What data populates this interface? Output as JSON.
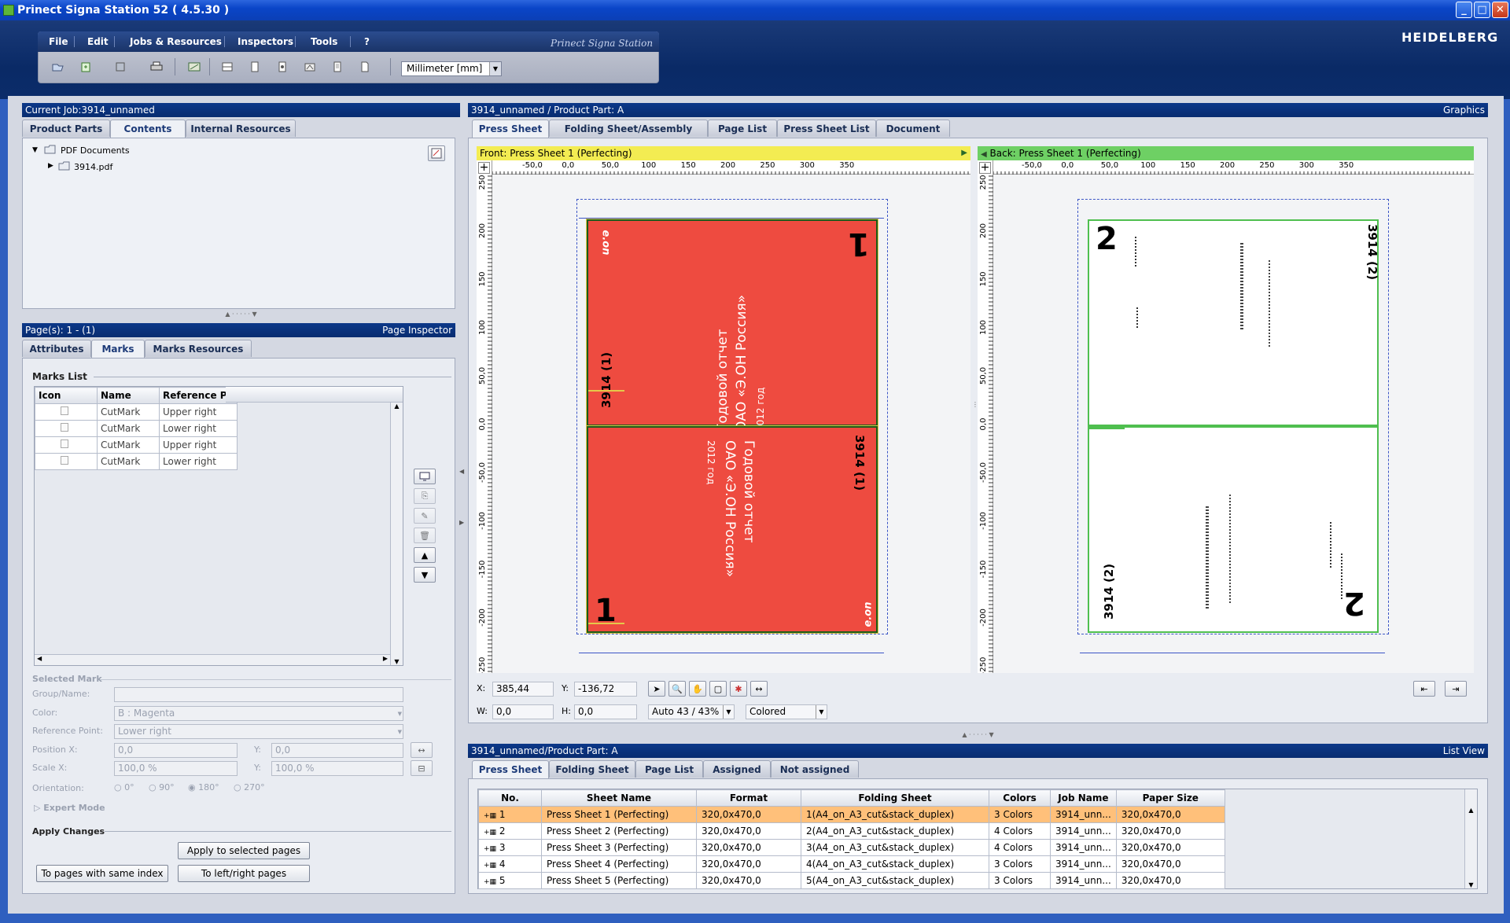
{
  "window": {
    "title": "Prinect Signa Station 52 ( 4.5.30 )",
    "brand": "Prinect Signa Station",
    "logo": "HEIDELBERG"
  },
  "menu": [
    "File",
    "Edit",
    "Jobs & Resources",
    "Inspectors",
    "Tools",
    "?"
  ],
  "toolbar": {
    "units": "Millimeter  [mm]"
  },
  "job_panel": {
    "title": "Current Job:3914_unnamed",
    "tabs": [
      "Product Parts",
      "Contents",
      "Internal Resources"
    ],
    "active_tab": "Contents",
    "tree": {
      "root": "PDF Documents",
      "child": "3914.pdf"
    }
  },
  "page_inspector": {
    "title": "Page(s): 1 - (1)",
    "title_right": "Page Inspector",
    "tabs": [
      "Attributes",
      "Marks",
      "Marks Resources"
    ],
    "active_tab": "Marks",
    "marks_list_label": "Marks List",
    "columns": [
      "Icon",
      "Name",
      "Reference Po"
    ],
    "rows": [
      {
        "name": "CutMark",
        "ref": "Upper right"
      },
      {
        "name": "CutMark",
        "ref": "Lower right"
      },
      {
        "name": "CutMark",
        "ref": "Upper right"
      },
      {
        "name": "CutMark",
        "ref": "Lower right"
      }
    ],
    "selected_mark": {
      "label": "Selected Mark",
      "group_name_label": "Group/Name:",
      "color_label": "Color:",
      "color_value": "B : Magenta",
      "ref_point_label": "Reference Point:",
      "ref_point_value": "Lower right",
      "pos_x_label": "Position X:",
      "pos_x": "0,0",
      "pos_y_label": "Y:",
      "pos_y": "0,0",
      "scale_x_label": "Scale X:",
      "scale_x": "100,0 %",
      "scale_y_label": "Y:",
      "scale_y": "100,0 %",
      "orientation_label": "Orientation:",
      "orientations": [
        "0°",
        "90°",
        "180°",
        "270°"
      ],
      "selected_orientation": "180°",
      "expert_mode": "Expert Mode"
    },
    "apply_changes": {
      "label": "Apply Changes",
      "apply_selected": "Apply to selected pages",
      "same_index": "To pages with same index",
      "left_right": "To left/right pages"
    }
  },
  "graphics": {
    "title": "3914_unnamed / Product Part: A",
    "title_right": "Graphics",
    "tabs": [
      "Press Sheet",
      "Folding Sheet/Assembly Block",
      "Page List",
      "Press Sheet List",
      "Document"
    ],
    "active_tab": "Press Sheet",
    "front_label": "Front:  Press Sheet 1 (Perfecting)",
    "back_label": "Back:  Press Sheet 1 (Perfecting)",
    "h_ticks": [
      "-50,0",
      "0,0",
      "50,0",
      "100",
      "150",
      "200",
      "250",
      "300",
      "350"
    ],
    "v_ticks": [
      "250",
      "200",
      "150",
      "100",
      "50,0",
      "0,0",
      "-50,0",
      "-100",
      "-150",
      "-200",
      "-250"
    ],
    "front": {
      "top_page_number": "1",
      "top_page_id": "3914 (1)",
      "bottom_page_number": "1",
      "bottom_page_id": "3914 (1)",
      "logo": "e.on",
      "cover_line1": "Годовой отчет",
      "cover_line2": "ОАО «Э.ОН Россия»",
      "cover_line3": "2012 год"
    },
    "back": {
      "page_number": "2",
      "page_id": "3914 (2)"
    },
    "coords": {
      "x_label": "X:",
      "x": "385,44",
      "y_label": "Y:",
      "y": "-136,72",
      "w_label": "W:",
      "w": "0,0",
      "h_label": "H:",
      "h": "0,0"
    },
    "zoom": "Auto 43 / 43%",
    "color_mode": "Colored"
  },
  "list_view": {
    "title": "3914_unnamed/Product Part: A",
    "title_right": "List View",
    "tabs": [
      "Press Sheet",
      "Folding Sheet",
      "Page List",
      "Assigned",
      "Not assigned"
    ],
    "active_tab": "Press Sheet",
    "columns": [
      "No.",
      "Sheet Name",
      "Format",
      "Folding Sheet",
      "Colors",
      "Job Name",
      "Paper Size"
    ],
    "rows": [
      {
        "no": "1",
        "name": "Press Sheet 1 (Perfecting)",
        "format": "320,0x470,0",
        "folding": "1(A4_on_A3_cut&stack_duplex)",
        "colors": "3 Colors",
        "job": "3914_unn...",
        "paper": "320,0x470,0"
      },
      {
        "no": "2",
        "name": "Press Sheet 2 (Perfecting)",
        "format": "320,0x470,0",
        "folding": "2(A4_on_A3_cut&stack_duplex)",
        "colors": "4 Colors",
        "job": "3914_unn...",
        "paper": "320,0x470,0"
      },
      {
        "no": "3",
        "name": "Press Sheet 3 (Perfecting)",
        "format": "320,0x470,0",
        "folding": "3(A4_on_A3_cut&stack_duplex)",
        "colors": "4 Colors",
        "job": "3914_unn...",
        "paper": "320,0x470,0"
      },
      {
        "no": "4",
        "name": "Press Sheet 4 (Perfecting)",
        "format": "320,0x470,0",
        "folding": "4(A4_on_A3_cut&stack_duplex)",
        "colors": "3 Colors",
        "job": "3914_unn...",
        "paper": "320,0x470,0"
      },
      {
        "no": "5",
        "name": "Press Sheet 5 (Perfecting)",
        "format": "320,0x470,0",
        "folding": "5(A4_on_A3_cut&stack_duplex)",
        "colors": "3 Colors",
        "job": "3914_unn...",
        "paper": "320,0x470,0"
      }
    ]
  },
  "colors": {
    "front_bar": "#f3ec52",
    "back_bar": "#6ed064",
    "page_red": "#ee4b40",
    "selected_row": "#ffc07a",
    "panel_header": "#0c3889"
  }
}
